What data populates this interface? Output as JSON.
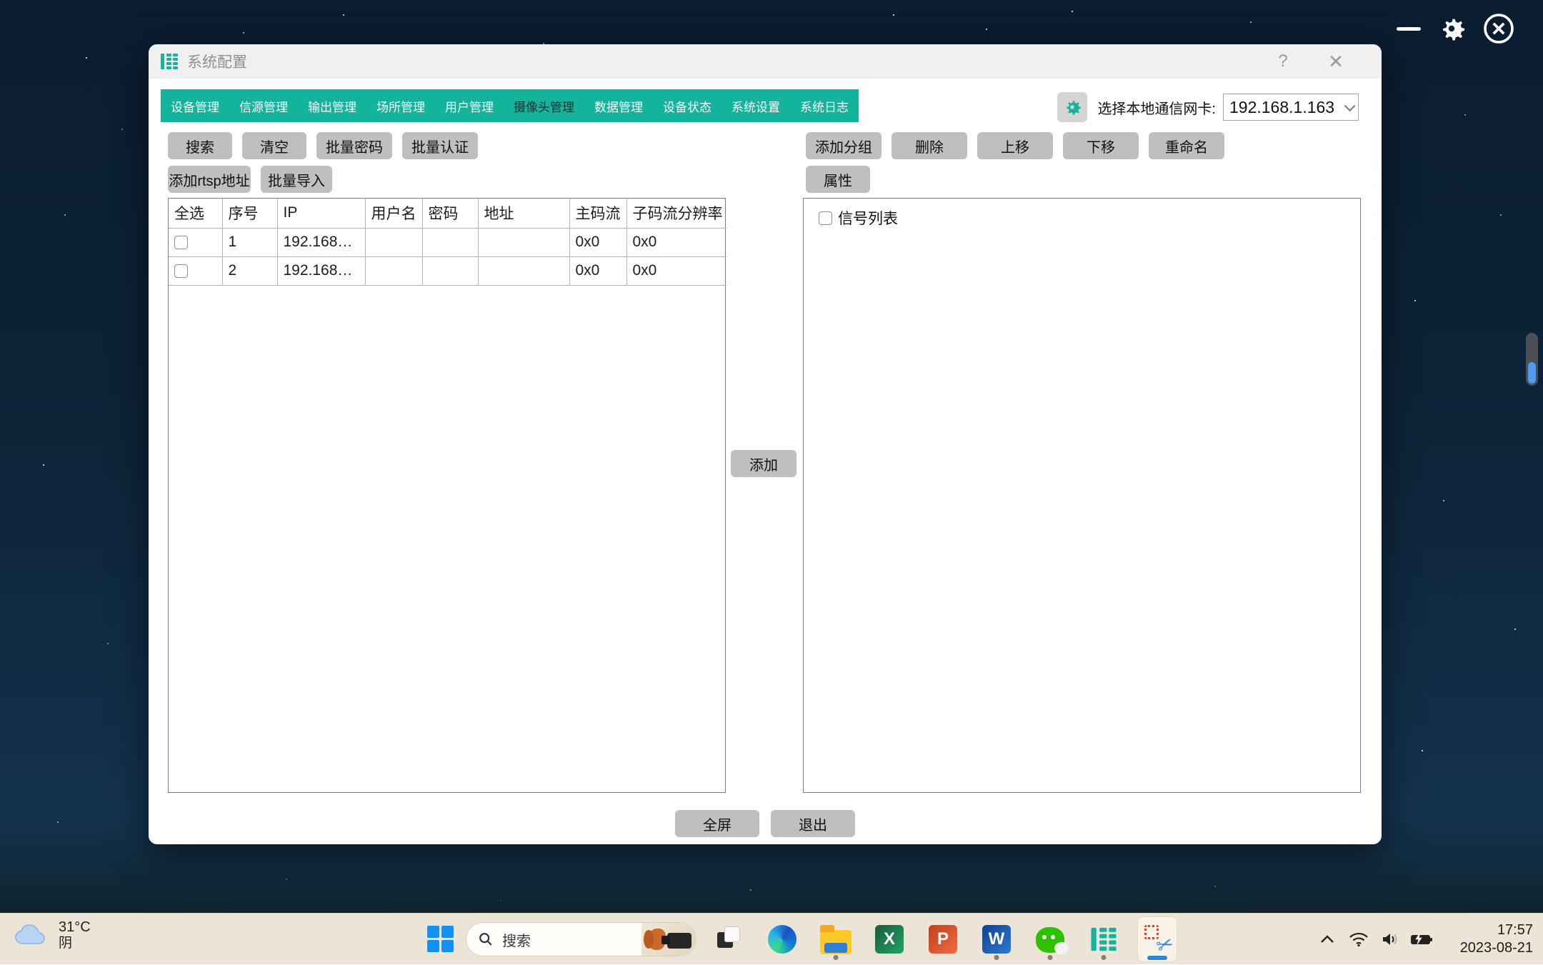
{
  "colors": {
    "accent": "#14b39b",
    "taskbar_bg": "#ece4d6",
    "button_bg": "#bfbfbf",
    "active_indicator": "#2b87d8"
  },
  "icons": {
    "title_icon": "grid-table-icon",
    "nic_gear": "gear-icon",
    "search": "magnifier-icon",
    "desktop_minimize": "minus-icon",
    "desktop_settings": "gear-icon",
    "desktop_close": "circled-x-icon",
    "tray": [
      "chevron-up-icon",
      "wifi-icon",
      "volume-icon",
      "battery-charging-icon"
    ],
    "weather": "cloud-icon",
    "snipping_scissors": "scissors-icon"
  },
  "window": {
    "title": "系统配置",
    "help_label": "?",
    "close_label": "✕",
    "tabs": [
      "设备管理",
      "信源管理",
      "输出管理",
      "场所管理",
      "用户管理",
      "摄像头管理",
      "数据管理",
      "设备状态",
      "系统设置",
      "系统日志"
    ],
    "active_tab": "摄像头管理",
    "nic": {
      "label": "选择本地通信网卡:",
      "value": "192.168.1.163"
    },
    "left_toolbar": [
      "搜索",
      "清空",
      "批量密码",
      "批量认证",
      "添加rtsp地址",
      "批量导入"
    ],
    "right_toolbar": [
      "添加分组",
      "删除",
      "上移",
      "下移",
      "重命名",
      "属性"
    ],
    "table": {
      "columns": [
        "全选",
        "序号",
        "IP",
        "用户名",
        "密码",
        "地址",
        "主码流",
        "子码流分辨率"
      ],
      "rows": [
        {
          "index": "1",
          "ip": "192.168…",
          "user": "",
          "pwd": "",
          "addr": "",
          "main": "0x0",
          "sub": "0x0"
        },
        {
          "index": "2",
          "ip": "192.168…",
          "user": "",
          "pwd": "",
          "addr": "",
          "main": "0x0",
          "sub": "0x0"
        }
      ]
    },
    "add_button": "添加",
    "signal_tree_root": "信号列表",
    "footer": {
      "fullscreen": "全屏",
      "exit": "退出"
    }
  },
  "taskbar": {
    "weather": {
      "temp": "31°C",
      "condition": "阴"
    },
    "search_placeholder": "搜索",
    "apps": [
      "task-view",
      "edge",
      "file-explorer",
      "excel",
      "powerpoint",
      "word",
      "wechat",
      "signal-manager",
      "screen-clip"
    ],
    "running_apps": [
      "file-explorer",
      "word",
      "wechat",
      "signal-manager"
    ],
    "active_app": "screen-clip",
    "tray": {
      "time": "17:57",
      "date": "2023-08-21"
    }
  }
}
